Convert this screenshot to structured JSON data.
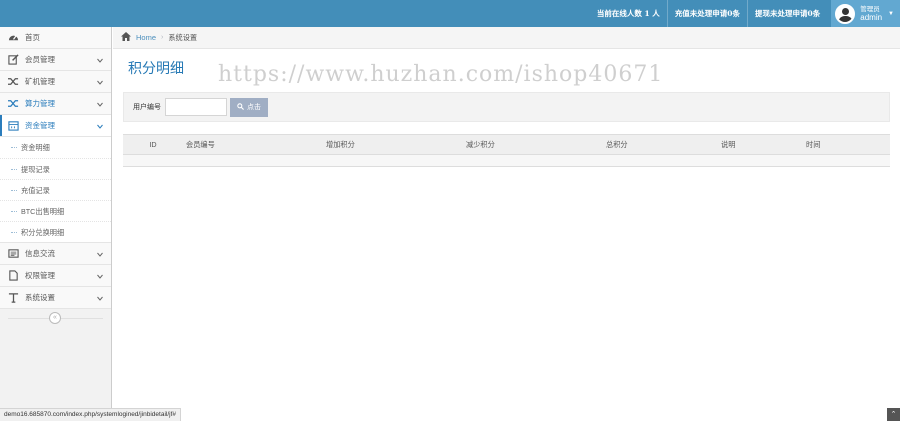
{
  "header": {
    "online_stat": "当前在线人数 1 人",
    "pending_recharge": "充值未处理申请0条",
    "pending_withdraw": "提现未处理申请0条",
    "user_role": "管理员",
    "user_name": "admin"
  },
  "sidebar": {
    "items": [
      {
        "label": "首页",
        "icon": "dashboard-icon"
      },
      {
        "label": "会员管理",
        "icon": "edit-icon"
      },
      {
        "label": "矿机管理",
        "icon": "shuffle-icon"
      },
      {
        "label": "算力管理",
        "icon": "shuffle-icon"
      },
      {
        "label": "资金管理",
        "icon": "calendar-icon"
      },
      {
        "label": "信息交流",
        "icon": "list-icon"
      },
      {
        "label": "权限管理",
        "icon": "file-icon"
      },
      {
        "label": "系统设置",
        "icon": "text-icon"
      }
    ],
    "submenu": [
      "资金明细",
      "提现记录",
      "充值记录",
      "BTC出售明细",
      "积分兑换明细"
    ]
  },
  "breadcrumb": {
    "home": "Home",
    "current": "系统设置"
  },
  "page": {
    "title": "积分明细",
    "watermark": "https://www.huzhan.com/ishop40671"
  },
  "search": {
    "label": "用户编号",
    "button": "点击"
  },
  "table": {
    "columns": [
      "ID",
      "会员编号",
      "增加积分",
      "减少积分",
      "总积分",
      "说明",
      "时间"
    ]
  },
  "status_url": "demo16.685870.com/index.php/systemlogined/jinbidetail/jf#",
  "colors": {
    "navbar": "#438eb9",
    "accent": "#2b7dbc"
  }
}
